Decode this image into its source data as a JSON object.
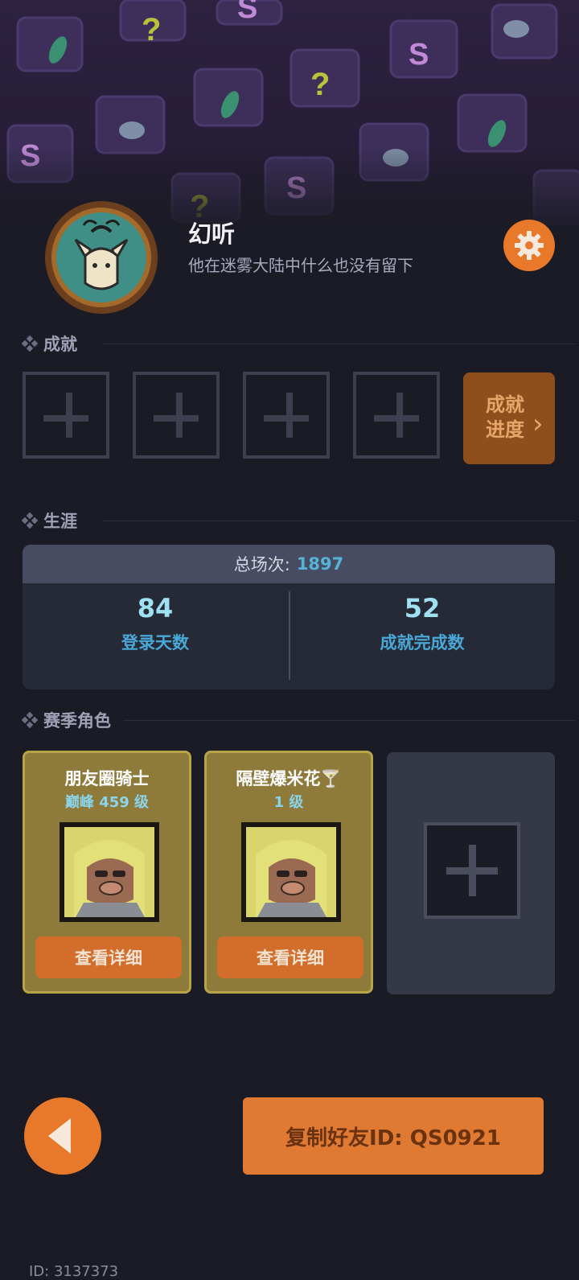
{
  "profile": {
    "name": "幻听",
    "bio": "他在迷雾大陆中什么也没有留下"
  },
  "sections": {
    "achievements": "成就",
    "career": "生涯",
    "season_roles": "赛季角色"
  },
  "achievements": {
    "slots": [
      "empty",
      "empty",
      "empty",
      "empty"
    ],
    "progress_label_line1": "成就",
    "progress_label_line2": "进度"
  },
  "career": {
    "total_label": "总场次:",
    "total_value": "1897",
    "login_days_value": "84",
    "login_days_label": "登录天数",
    "achievements_done_value": "52",
    "achievements_done_label": "成就完成数"
  },
  "roles": [
    {
      "name": "朋友圈骑士",
      "level": "巅峰 459 级",
      "button": "查看详细"
    },
    {
      "name": "隔壁爆米花🍸",
      "level": "1 级",
      "button": "查看详细"
    }
  ],
  "footer": {
    "copy_button": "复制好友ID: QS0921",
    "user_id": "ID: 3137373"
  },
  "colors": {
    "accent_orange": "#e8792b",
    "stat_blue": "#49a8d6",
    "card_gold": "#8e7b3c"
  }
}
